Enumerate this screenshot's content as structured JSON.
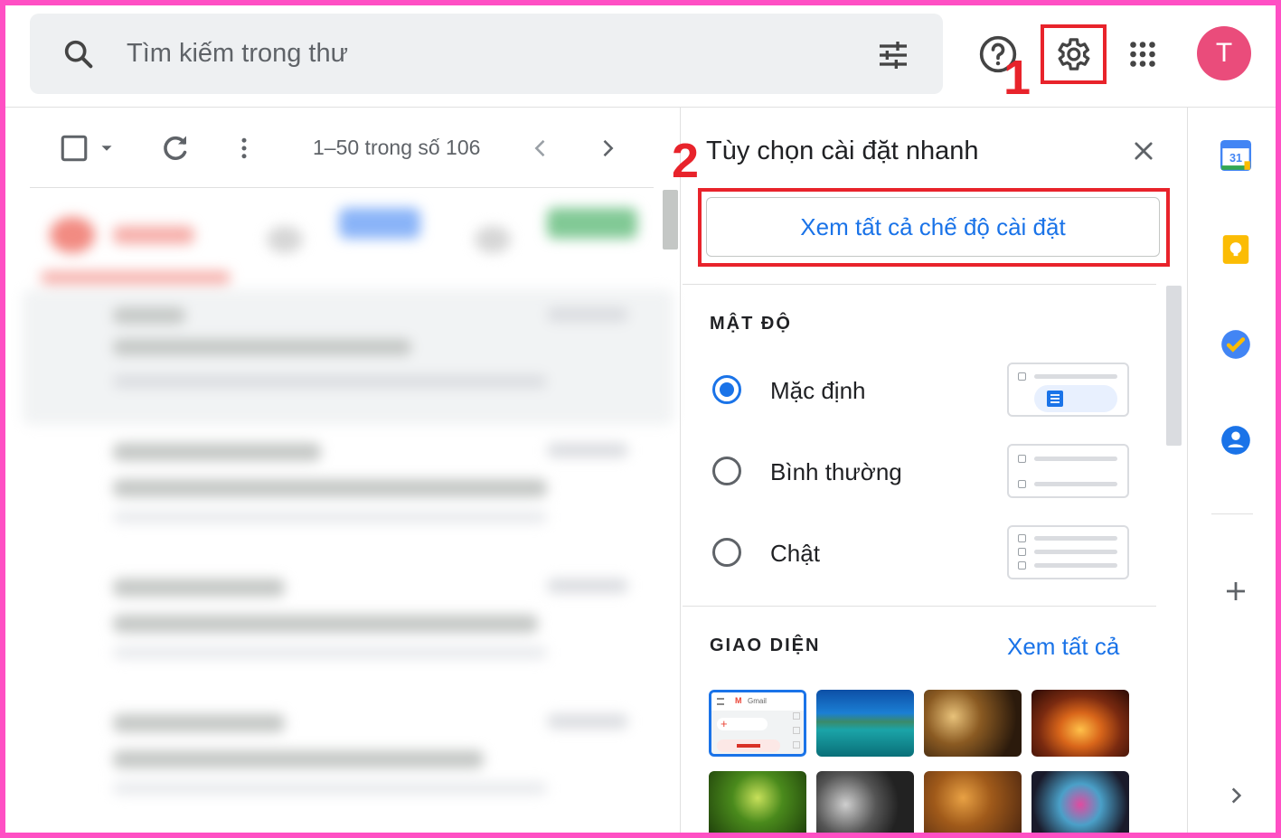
{
  "search": {
    "placeholder": "Tìm kiếm trong thư"
  },
  "header": {
    "avatar_letter": "T",
    "icons": [
      "search-icon",
      "filter-icon",
      "help-icon",
      "settings-icon",
      "apps-icon"
    ]
  },
  "annotations": {
    "step1": "1",
    "step2": "2",
    "color": "#e8232b"
  },
  "toolbar": {
    "count": "1–50 trong số 106"
  },
  "quick_settings": {
    "title": "Tùy chọn cài đặt nhanh",
    "see_all_settings": "Xem tất cả chế độ cài đặt",
    "density": {
      "label": "MẬT ĐỘ",
      "options": [
        {
          "label": "Mặc định",
          "selected": true
        },
        {
          "label": "Bình thường",
          "selected": false
        },
        {
          "label": "Chật",
          "selected": false
        }
      ]
    },
    "theme": {
      "label": "GIAO DIỆN",
      "see_all": "Xem tất cả",
      "gmail_thumb_text": "Gmail"
    }
  },
  "colors": {
    "accent": "#1a73e8",
    "avatar": "#ea4c7b",
    "frame": "#ff4fc4"
  }
}
